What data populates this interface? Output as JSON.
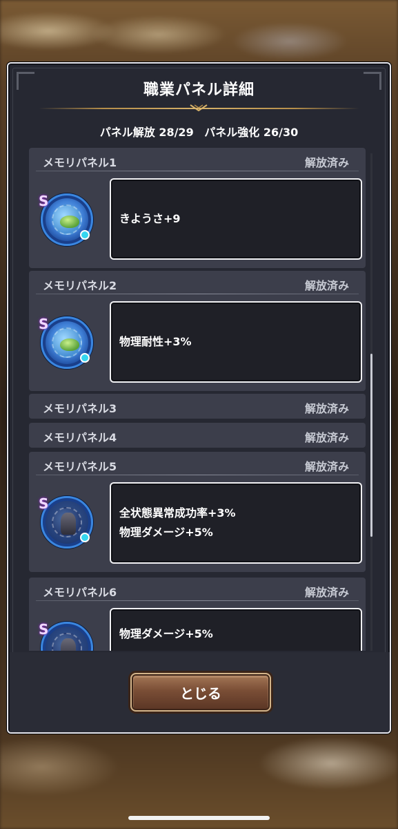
{
  "dialog": {
    "title": "職業パネル詳細",
    "stats": {
      "unlock": "パネル解放 28/29",
      "enhance": "パネル強化 26/30"
    },
    "close_label": "とじる"
  },
  "panels": [
    {
      "name": "メモリパネル1",
      "status": "解放済み",
      "expanded": true,
      "medal_icon": "slime-medal-icon",
      "effects": [
        "きようさ+9"
      ]
    },
    {
      "name": "メモリパネル2",
      "status": "解放済み",
      "expanded": true,
      "medal_icon": "slime-medal-icon",
      "effects": [
        "物理耐性+3%"
      ]
    },
    {
      "name": "メモリパネル3",
      "status": "解放済み",
      "expanded": false
    },
    {
      "name": "メモリパネル4",
      "status": "解放済み",
      "expanded": false
    },
    {
      "name": "メモリパネル5",
      "status": "解放済み",
      "expanded": true,
      "medal_icon": "armor-knight-medal-icon",
      "effects": [
        "全状態異常成功率+3%",
        "物理ダメージ+5%"
      ]
    },
    {
      "name": "メモリパネル6",
      "status": "解放済み",
      "expanded": true,
      "medal_icon": "armor-knight-medal-icon",
      "effects": [
        "物理ダメージ+5%"
      ]
    }
  ],
  "medal_rank": "S",
  "colors": {
    "dialog_bg": "#262832",
    "panel_bg": "#3c3e4b",
    "effect_bg": "#1f2027",
    "gold_accent": "#d8b36a",
    "button_brown": "#7a4e36"
  }
}
